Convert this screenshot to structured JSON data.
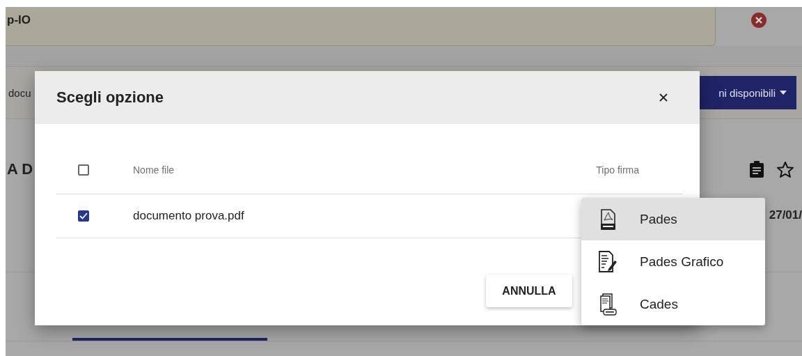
{
  "background": {
    "banner": {
      "text": "p-IO"
    },
    "toolbar": {
      "text": "docu",
      "button": "ni disponibili"
    },
    "heading": "A D",
    "date": "27/01/"
  },
  "dialog": {
    "title": "Scegli opzione",
    "table": {
      "header_checked": false,
      "columns": [
        "Nome file",
        "Tipo firma"
      ],
      "rows": [
        {
          "checked": true,
          "name": "documento prova.pdf"
        }
      ]
    },
    "buttons": [
      "ANNULLA"
    ]
  },
  "menu": {
    "items": [
      {
        "label": "Pades",
        "kind": "pdf",
        "selected": true
      },
      {
        "label": "Pades Grafico",
        "kind": "sign",
        "selected": false
      },
      {
        "label": "Cades",
        "kind": "p7m",
        "selected": false
      }
    ]
  }
}
